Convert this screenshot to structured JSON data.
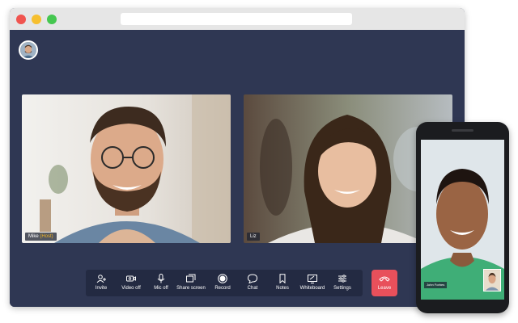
{
  "participants": {
    "host": {
      "name": "Mike",
      "badge": "(Host)"
    },
    "guest": {
      "name": "Liz"
    },
    "phone_user": {
      "name": "John Forbes"
    }
  },
  "toolbar": {
    "items": [
      {
        "label": "Invite",
        "icon": "invite-icon"
      },
      {
        "label": "Video off",
        "icon": "camera-icon"
      },
      {
        "label": "Mic off",
        "icon": "microphone-icon"
      },
      {
        "label": "Share screen",
        "icon": "share-screen-icon"
      },
      {
        "label": "Record",
        "icon": "record-icon"
      },
      {
        "label": "Chat",
        "icon": "chat-icon"
      },
      {
        "label": "Notes",
        "icon": "bookmark-icon"
      },
      {
        "label": "Whiteboard",
        "icon": "whiteboard-icon"
      },
      {
        "label": "Settings",
        "icon": "sliders-icon"
      }
    ],
    "leave_label": "Leave"
  },
  "colors": {
    "background": "#2f3753",
    "toolbar": "#232a42",
    "leave": "#e8505b",
    "host_badge": "#f4b524"
  }
}
